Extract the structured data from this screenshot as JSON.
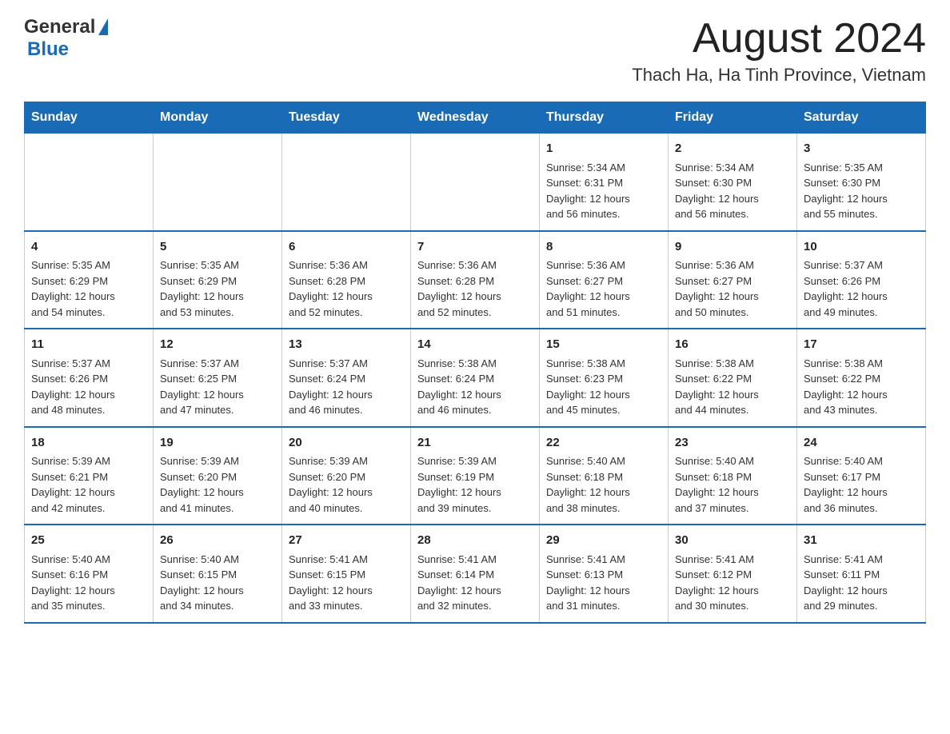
{
  "header": {
    "logo_general": "General",
    "logo_blue": "Blue",
    "month_year": "August 2024",
    "location": "Thach Ha, Ha Tinh Province, Vietnam"
  },
  "weekdays": [
    "Sunday",
    "Monday",
    "Tuesday",
    "Wednesday",
    "Thursday",
    "Friday",
    "Saturday"
  ],
  "weeks": [
    [
      {
        "day": "",
        "info": ""
      },
      {
        "day": "",
        "info": ""
      },
      {
        "day": "",
        "info": ""
      },
      {
        "day": "",
        "info": ""
      },
      {
        "day": "1",
        "info": "Sunrise: 5:34 AM\nSunset: 6:31 PM\nDaylight: 12 hours\nand 56 minutes."
      },
      {
        "day": "2",
        "info": "Sunrise: 5:34 AM\nSunset: 6:30 PM\nDaylight: 12 hours\nand 56 minutes."
      },
      {
        "day": "3",
        "info": "Sunrise: 5:35 AM\nSunset: 6:30 PM\nDaylight: 12 hours\nand 55 minutes."
      }
    ],
    [
      {
        "day": "4",
        "info": "Sunrise: 5:35 AM\nSunset: 6:29 PM\nDaylight: 12 hours\nand 54 minutes."
      },
      {
        "day": "5",
        "info": "Sunrise: 5:35 AM\nSunset: 6:29 PM\nDaylight: 12 hours\nand 53 minutes."
      },
      {
        "day": "6",
        "info": "Sunrise: 5:36 AM\nSunset: 6:28 PM\nDaylight: 12 hours\nand 52 minutes."
      },
      {
        "day": "7",
        "info": "Sunrise: 5:36 AM\nSunset: 6:28 PM\nDaylight: 12 hours\nand 52 minutes."
      },
      {
        "day": "8",
        "info": "Sunrise: 5:36 AM\nSunset: 6:27 PM\nDaylight: 12 hours\nand 51 minutes."
      },
      {
        "day": "9",
        "info": "Sunrise: 5:36 AM\nSunset: 6:27 PM\nDaylight: 12 hours\nand 50 minutes."
      },
      {
        "day": "10",
        "info": "Sunrise: 5:37 AM\nSunset: 6:26 PM\nDaylight: 12 hours\nand 49 minutes."
      }
    ],
    [
      {
        "day": "11",
        "info": "Sunrise: 5:37 AM\nSunset: 6:26 PM\nDaylight: 12 hours\nand 48 minutes."
      },
      {
        "day": "12",
        "info": "Sunrise: 5:37 AM\nSunset: 6:25 PM\nDaylight: 12 hours\nand 47 minutes."
      },
      {
        "day": "13",
        "info": "Sunrise: 5:37 AM\nSunset: 6:24 PM\nDaylight: 12 hours\nand 46 minutes."
      },
      {
        "day": "14",
        "info": "Sunrise: 5:38 AM\nSunset: 6:24 PM\nDaylight: 12 hours\nand 46 minutes."
      },
      {
        "day": "15",
        "info": "Sunrise: 5:38 AM\nSunset: 6:23 PM\nDaylight: 12 hours\nand 45 minutes."
      },
      {
        "day": "16",
        "info": "Sunrise: 5:38 AM\nSunset: 6:22 PM\nDaylight: 12 hours\nand 44 minutes."
      },
      {
        "day": "17",
        "info": "Sunrise: 5:38 AM\nSunset: 6:22 PM\nDaylight: 12 hours\nand 43 minutes."
      }
    ],
    [
      {
        "day": "18",
        "info": "Sunrise: 5:39 AM\nSunset: 6:21 PM\nDaylight: 12 hours\nand 42 minutes."
      },
      {
        "day": "19",
        "info": "Sunrise: 5:39 AM\nSunset: 6:20 PM\nDaylight: 12 hours\nand 41 minutes."
      },
      {
        "day": "20",
        "info": "Sunrise: 5:39 AM\nSunset: 6:20 PM\nDaylight: 12 hours\nand 40 minutes."
      },
      {
        "day": "21",
        "info": "Sunrise: 5:39 AM\nSunset: 6:19 PM\nDaylight: 12 hours\nand 39 minutes."
      },
      {
        "day": "22",
        "info": "Sunrise: 5:40 AM\nSunset: 6:18 PM\nDaylight: 12 hours\nand 38 minutes."
      },
      {
        "day": "23",
        "info": "Sunrise: 5:40 AM\nSunset: 6:18 PM\nDaylight: 12 hours\nand 37 minutes."
      },
      {
        "day": "24",
        "info": "Sunrise: 5:40 AM\nSunset: 6:17 PM\nDaylight: 12 hours\nand 36 minutes."
      }
    ],
    [
      {
        "day": "25",
        "info": "Sunrise: 5:40 AM\nSunset: 6:16 PM\nDaylight: 12 hours\nand 35 minutes."
      },
      {
        "day": "26",
        "info": "Sunrise: 5:40 AM\nSunset: 6:15 PM\nDaylight: 12 hours\nand 34 minutes."
      },
      {
        "day": "27",
        "info": "Sunrise: 5:41 AM\nSunset: 6:15 PM\nDaylight: 12 hours\nand 33 minutes."
      },
      {
        "day": "28",
        "info": "Sunrise: 5:41 AM\nSunset: 6:14 PM\nDaylight: 12 hours\nand 32 minutes."
      },
      {
        "day": "29",
        "info": "Sunrise: 5:41 AM\nSunset: 6:13 PM\nDaylight: 12 hours\nand 31 minutes."
      },
      {
        "day": "30",
        "info": "Sunrise: 5:41 AM\nSunset: 6:12 PM\nDaylight: 12 hours\nand 30 minutes."
      },
      {
        "day": "31",
        "info": "Sunrise: 5:41 AM\nSunset: 6:11 PM\nDaylight: 12 hours\nand 29 minutes."
      }
    ]
  ]
}
